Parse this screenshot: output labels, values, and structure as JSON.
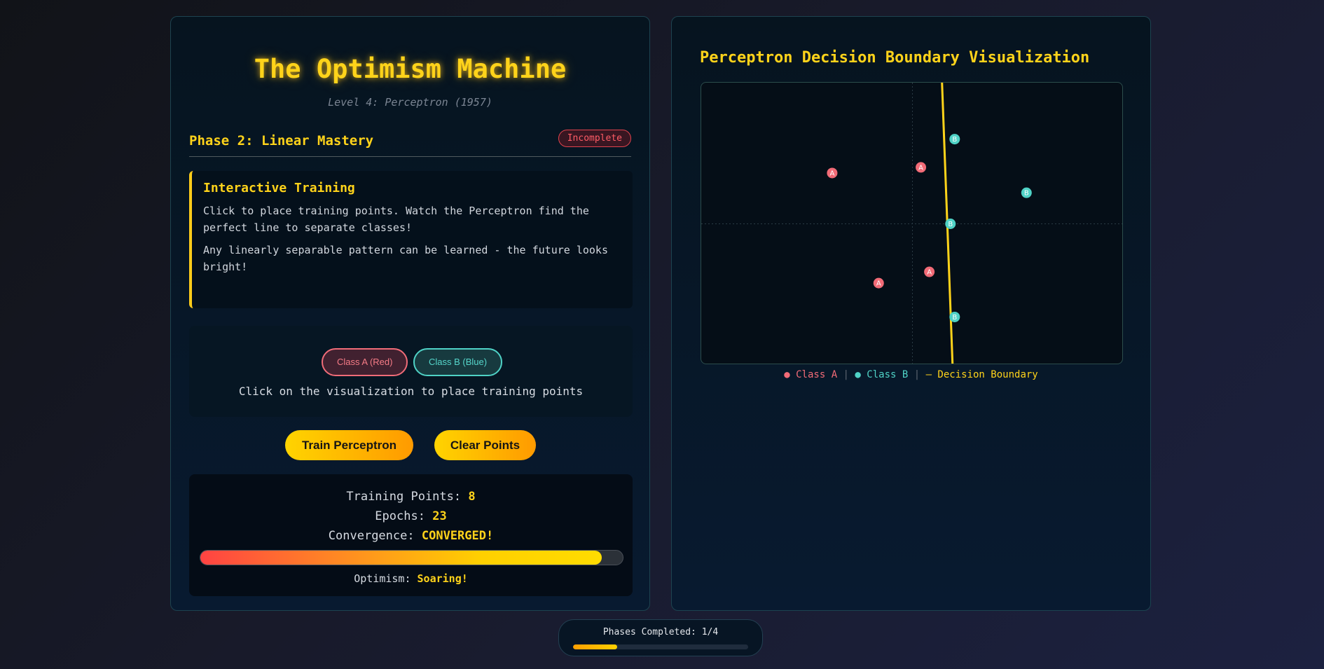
{
  "header": {
    "title": "The Optimism Machine",
    "subtitle": "Level 4: Perceptron (1957)"
  },
  "phase": {
    "title": "Phase 2: Linear Mastery",
    "status": "Incomplete"
  },
  "info": {
    "title": "Interactive Training",
    "paragraph1": "Click to place training points. Watch the Perceptron find the perfect line to separate classes!",
    "paragraph2": "Any linearly separable pattern can be learned - the future looks bright!"
  },
  "class_selector": {
    "class_a_label": "Class A (Red)",
    "class_b_label": "Class B (Blue)",
    "hint": "Click on the visualization to place training points"
  },
  "actions": {
    "train_label": "Train Perceptron",
    "clear_label": "Clear Points"
  },
  "stats": {
    "points_label": "Training Points:",
    "points_value": "8",
    "epochs_label": "Epochs:",
    "epochs_value": "23",
    "convergence_label": "Convergence:",
    "convergence_value": "CONVERGED!",
    "optimism_progress": 0.95,
    "optimism_label": "Optimism:",
    "optimism_value": "Soaring!"
  },
  "visualization": {
    "title": "Perceptron Decision Boundary Visualization",
    "points": [
      {
        "label": "A",
        "cls": "a",
        "x": 0.31,
        "y": 0.32
      },
      {
        "label": "A",
        "cls": "a",
        "x": 0.52,
        "y": 0.3
      },
      {
        "label": "A",
        "cls": "a",
        "x": 0.42,
        "y": 0.71
      },
      {
        "label": "A",
        "cls": "a",
        "x": 0.54,
        "y": 0.67
      },
      {
        "label": "B",
        "cls": "b",
        "x": 0.6,
        "y": 0.2
      },
      {
        "label": "B",
        "cls": "b",
        "x": 0.77,
        "y": 0.39
      },
      {
        "label": "B",
        "cls": "b",
        "x": 0.59,
        "y": 0.5
      },
      {
        "label": "B",
        "cls": "b",
        "x": 0.6,
        "y": 0.83
      }
    ],
    "boundary": {
      "x_top": 0.57,
      "x_bottom": 0.595
    },
    "class_a_color": "#f26b77",
    "class_b_color": "#4fd2c6",
    "boundary_color": "#ffd31a",
    "legend": {
      "class_a": "● Class A",
      "sep1": " | ",
      "class_b": "● Class B",
      "sep2": " | ",
      "boundary": "— Decision Boundary"
    }
  },
  "footer": {
    "text": "Phases Completed: 1/4",
    "progress": 0.25
  }
}
